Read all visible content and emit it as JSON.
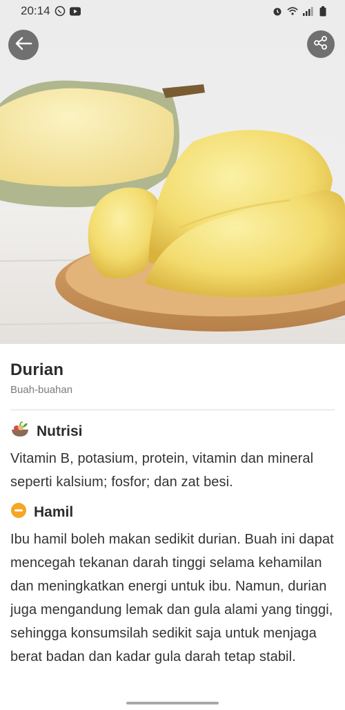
{
  "status_bar": {
    "time": "20:14",
    "left_icons": [
      "whatsapp-icon",
      "youtube-icon"
    ],
    "right_icons": [
      "alarm-icon",
      "wifi-icon",
      "signal-icon",
      "battery-icon"
    ]
  },
  "header": {
    "back_icon": "arrow-left-icon",
    "share_icon": "share-icon"
  },
  "food": {
    "name": "Durian",
    "category": "Buah-buahan"
  },
  "nutrition": {
    "title": "Nutrisi",
    "icon": "salad-bowl-icon",
    "text": "Vitamin B, potasium, protein, vitamin dan mineral seperti kalsium; fosfor; dan zat besi."
  },
  "pregnancy": {
    "title": "Hamil",
    "icon": "minus-circle-icon",
    "status_color": "#f5a623",
    "text": "Ibu hamil boleh makan sedikit durian. Buah ini dapat mencegah tekanan darah tinggi selama kehamilan dan meningkatkan energi untuk ibu. Namun, durian juga mengandung lemak dan gula alami yang tinggi, sehingga konsumsilah sedikit saja untuk menjaga berat badan dan kadar gula darah tetap stabil."
  }
}
